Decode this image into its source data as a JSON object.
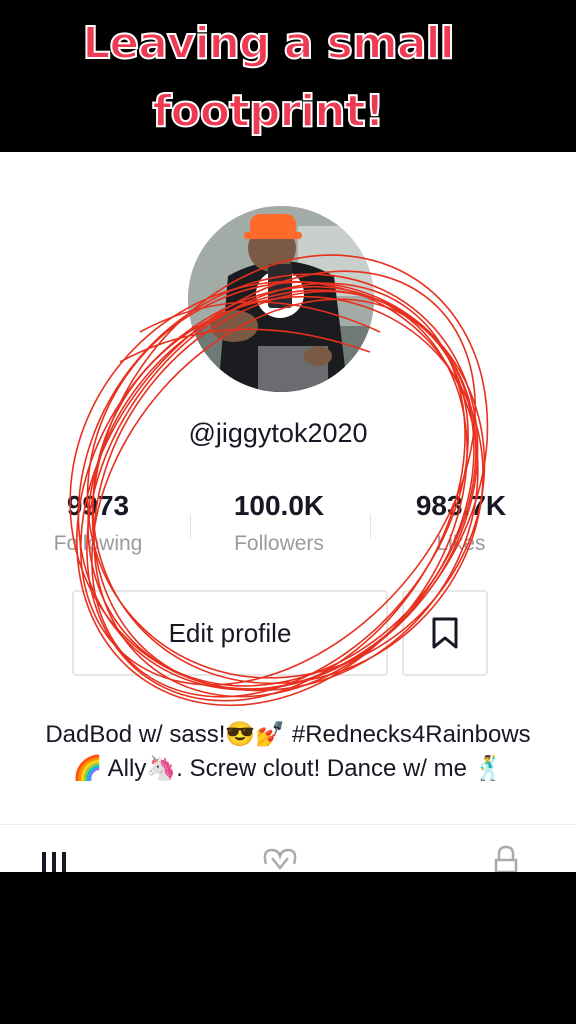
{
  "overlay": {
    "caption_line1": "Leaving a small",
    "caption_line2": "footprint!"
  },
  "profile": {
    "handle": "@jiggytok2020",
    "stats": [
      {
        "value": "9973",
        "label": "Following"
      },
      {
        "value": "100.0K",
        "label": "Followers"
      },
      {
        "value": "983.7K",
        "label": "Likes"
      }
    ],
    "edit_label": "Edit profile",
    "bio_line1": "DadBod w/ sass!😎💅 #Rednecks4Rainbows",
    "bio_line2": "🌈 Ally🦄. Screw clout! Dance w/ me 🕺"
  },
  "tabs": [
    "grid-icon",
    "liked-icon",
    "lock-icon"
  ],
  "colors": {
    "caption": "#ee3b53",
    "scribble": "#e8301e",
    "muted_text": "#9a9ba0"
  }
}
